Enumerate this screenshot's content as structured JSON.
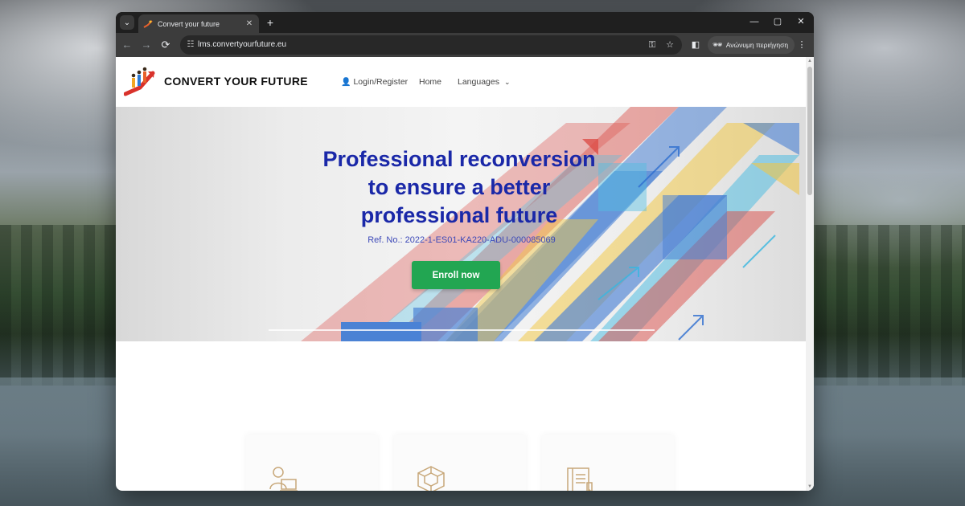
{
  "browser": {
    "tab_title": "Convert your future",
    "tab_close": "✕",
    "new_tab": "+",
    "url": "lms.convertyourfuture.eu",
    "incognito_label": "Ανώνυμη περιήγηση",
    "window_controls": {
      "minimize": "—",
      "maximize": "▢",
      "close": "✕"
    },
    "nav": {
      "back": "←",
      "forward": "→",
      "reload": "⟳"
    },
    "icons": {
      "tab_search": "chevron-down-icon",
      "site_info": "tune-icon",
      "password": "key-icon",
      "bookmark": "star-icon",
      "side_panel": "side-panel-icon",
      "menu": "more-vert-icon"
    }
  },
  "site": {
    "brand": "CONVERT YOUR FUTURE",
    "nav": {
      "login": "Login/Register",
      "home": "Home",
      "languages": "Languages"
    },
    "hero": {
      "title_line1": "Professional reconversion",
      "title_line2": "to ensure a better",
      "title_line3": "professional future",
      "ref": "Ref. No.: 2022-1-ES01-KA220-ADU-000085069",
      "cta": "Enroll now"
    },
    "cards": [
      {
        "icon": "online-learner-icon"
      },
      {
        "icon": "cube-network-icon"
      },
      {
        "icon": "book-certificate-icon"
      }
    ]
  },
  "colors": {
    "hero_title": "#1a28a8",
    "cta_green": "#22a652",
    "arrow_blue": "#2f6fd0",
    "arrow_red": "#d94b4b",
    "arrow_yellow": "#f2c230",
    "arrow_cyan": "#38b6e0",
    "card_icon": "#c8a87a"
  }
}
